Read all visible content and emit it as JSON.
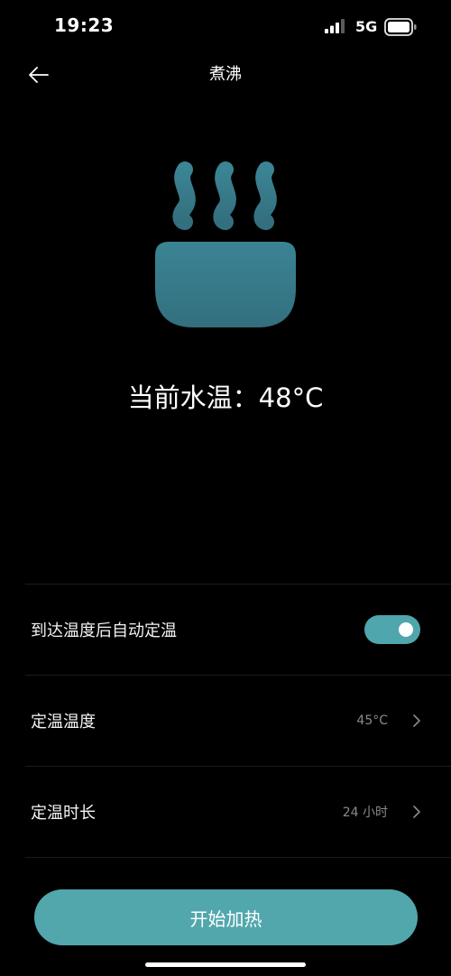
{
  "status_bar": {
    "time": "19:23",
    "network": "5G"
  },
  "header": {
    "title": "煮沸"
  },
  "current_temperature": {
    "label": "当前水温：48°C"
  },
  "settings": {
    "auto_keep_warm": {
      "label": "到达温度后自动定温",
      "enabled": true
    },
    "keep_warm_temperature": {
      "label": "定温温度",
      "value": "45°C"
    },
    "keep_warm_duration": {
      "label": "定温时长",
      "value": "24 小时"
    }
  },
  "actions": {
    "start_label": "开始加热"
  },
  "colors": {
    "accent": "#52a7ad",
    "illustration": "#3b7f8c"
  }
}
